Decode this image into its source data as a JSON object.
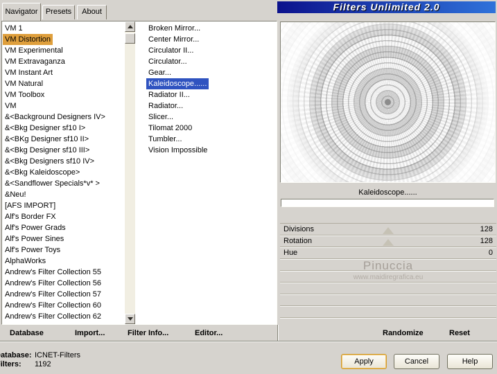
{
  "window": {
    "title": "Filters Unlimited 2.0"
  },
  "tabs": [
    {
      "label": "Navigator",
      "active": true
    },
    {
      "label": "Presets",
      "active": false
    },
    {
      "label": "About",
      "active": false
    }
  ],
  "colors": {
    "dialog_background": "#d6d3ce",
    "category_selection": "#df9f3c",
    "filter_selection": "#2f53c0",
    "banner_gradient_start": "#0c128c",
    "banner_gradient_end": "#2f72da",
    "apply_focus_border": "#cf9a2e"
  },
  "category_list": {
    "items": [
      "VM 1",
      "VM Distortion",
      "VM Experimental",
      "VM Extravaganza",
      "VM Instant Art",
      "VM Natural",
      "VM Toolbox",
      "VM",
      "&<Background Designers IV>",
      "&<Bkg Designer sf10 I>",
      "&<BKg Designer sf10 II>",
      "&<Bkg Designer sf10 III>",
      "&<Bkg Designers sf10 IV>",
      "&<Bkg Kaleidoscope>",
      "&<Sandflower Specials*v* >",
      "&Neu!",
      "[AFS IMPORT]",
      "Alf's Border FX",
      "Alf's Power Grads",
      "Alf's Power Sines",
      "Alf's Power Toys",
      "AlphaWorks",
      "Andrew's Filter Collection 55",
      "Andrew's Filter Collection 56",
      "Andrew's Filter Collection 57",
      "Andrew's Filter Collection 60",
      "Andrew's Filter Collection 62"
    ],
    "selected_index": 1,
    "selected_item": "VM Distortion"
  },
  "filter_list": {
    "items": [
      "Broken Mirror...",
      "Center Mirror...",
      "Circulator II...",
      "Circulator...",
      "Gear...",
      "Kaleidoscope......",
      "Radiator II...",
      "Radiator...",
      "Slicer...",
      "Tilomat 2000",
      "Tumbler...",
      "Vision Impossible"
    ],
    "selected_index": 5,
    "selected_item": "Kaleidoscope......"
  },
  "preview": {
    "label": "Kaleidoscope......"
  },
  "params": [
    {
      "label": "Divisions",
      "value": "128"
    },
    {
      "label": "Rotation",
      "value": "128"
    },
    {
      "label": "Hue",
      "value": "0"
    }
  ],
  "watermark": {
    "line1": "Pinuccia",
    "line2": "www.maidiregrafica.eu"
  },
  "toolbar": {
    "database": "Database",
    "import": "Import...",
    "filter_info": "Filter Info...",
    "editor": "Editor...",
    "randomize": "Randomize",
    "reset": "Reset"
  },
  "status": {
    "database_label": "Database:",
    "database_value": "ICNET-Filters",
    "filters_label": "Filters:",
    "filters_value": "1192"
  },
  "action_buttons": {
    "apply": "Apply",
    "cancel": "Cancel",
    "help": "Help"
  }
}
